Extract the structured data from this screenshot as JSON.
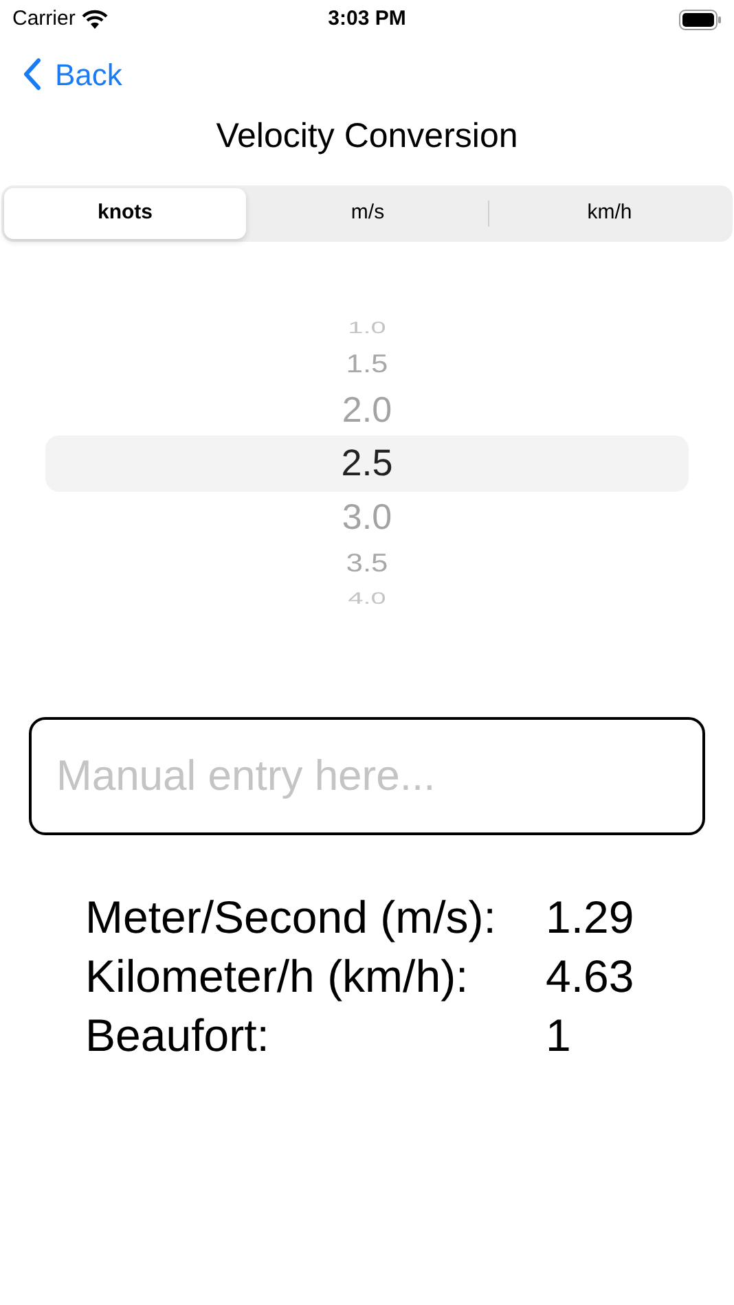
{
  "status_bar": {
    "carrier": "Carrier",
    "time": "3:03 PM"
  },
  "nav": {
    "back": "Back",
    "title": "Velocity Conversion"
  },
  "tabs": [
    {
      "label": "knots",
      "selected": true
    },
    {
      "label": "m/s",
      "selected": false
    },
    {
      "label": "km/h",
      "selected": false
    }
  ],
  "picker": [
    {
      "label": "1.0",
      "selected": false
    },
    {
      "label": "1.5",
      "selected": false
    },
    {
      "label": "2.0",
      "selected": false
    },
    {
      "label": "2.5",
      "selected": true
    },
    {
      "label": "3.0",
      "selected": false
    },
    {
      "label": "3.5",
      "selected": false
    },
    {
      "label": "4.0",
      "selected": false
    }
  ],
  "manual_entry": {
    "placeholder": "Manual entry here..."
  },
  "results": [
    {
      "label": "Meter/Second (m/s):",
      "value": "1.29"
    },
    {
      "label": "Kilometer/h (km/h):",
      "value": "4.63"
    },
    {
      "label": "Beaufort:",
      "value": "1"
    }
  ]
}
